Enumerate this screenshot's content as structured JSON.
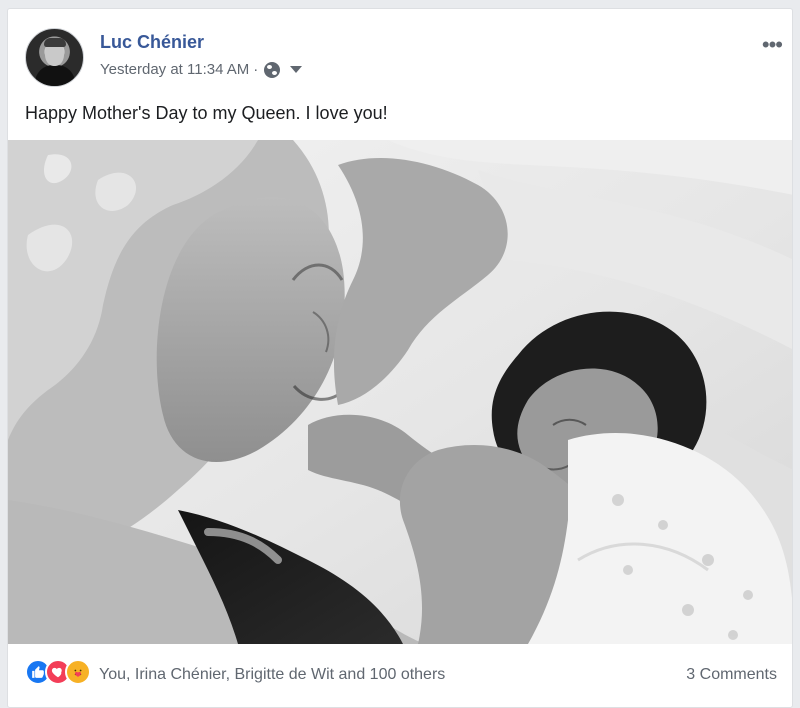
{
  "post": {
    "author": "Luc Chénier",
    "timestamp": "Yesterday at 11:34 AM",
    "separator": "·",
    "privacy_icon": "globe-icon",
    "more_icon": "more-options-icon",
    "text": "Happy Mother's Day to my Queen. I love you!"
  },
  "footer": {
    "reaction_icons": [
      "like-icon",
      "love-icon",
      "care-icon"
    ],
    "reactions_text": "You, Irina Chénier, Brigitte de Wit and 100 others",
    "comments_text": "3 Comments"
  },
  "colors": {
    "author_blue": "#385898",
    "meta_gray": "#606770",
    "like_blue": "#1877f2",
    "love_red": "#f33e58",
    "care_yellow": "#f7b125"
  }
}
